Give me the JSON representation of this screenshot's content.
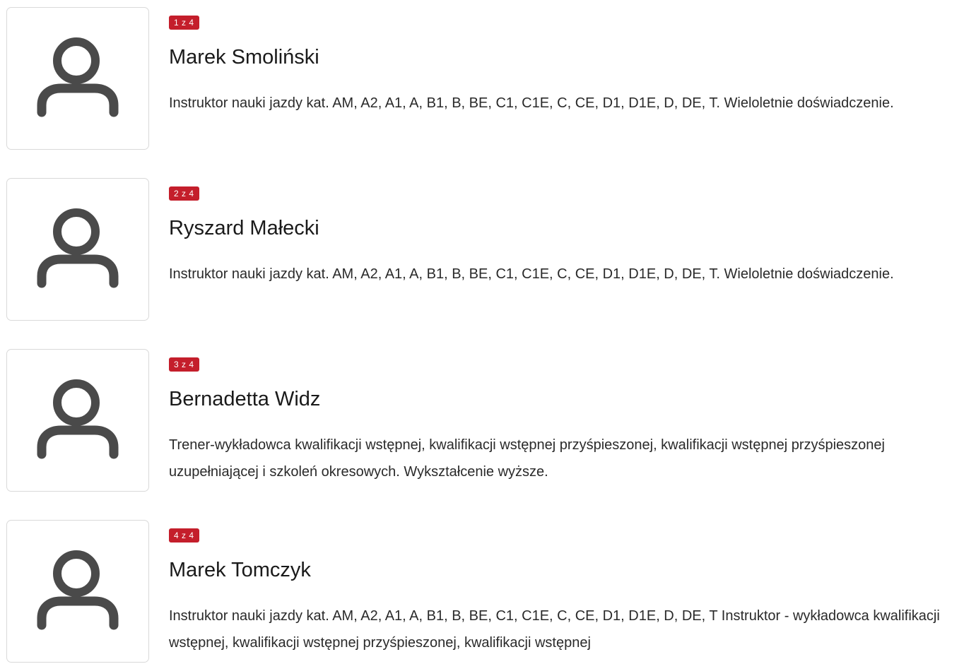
{
  "staff": [
    {
      "counter": "1 z 4",
      "name": "Marek Smoliński",
      "description": "Instruktor nauki jazdy kat. AM, A2, A1, A, B1, B, BE, C1, C1E, C, CE, D1, D1E, D, DE, T. Wieloletnie doświadczenie.",
      "avatar_icon": "user-outline-icon"
    },
    {
      "counter": "2 z 4",
      "name": "Ryszard Małecki",
      "description": "Instruktor nauki jazdy kat. AM, A2, A1, A, B1, B, BE, C1, C1E, C, CE, D1, D1E, D, DE, T. Wieloletnie doświadczenie.",
      "avatar_icon": "user-outline-icon"
    },
    {
      "counter": "3 z 4",
      "name": "Bernadetta Widz",
      "description": "Trener-wykładowca kwalifikacji wstępnej, kwalifikacji wstępnej przyśpieszonej, kwalifikacji wstępnej przyśpieszonej uzupełniającej i szkoleń okresowych. Wykształcenie wyższe.",
      "avatar_icon": "user-outline-icon"
    },
    {
      "counter": "4 z 4",
      "name": "Marek Tomczyk",
      "description": "Instruktor nauki jazdy kat. AM, A2, A1, A, B1, B, BE, C1, C1E, C, CE, D1, D1E, D, DE, T Instruktor - wykładowca kwalifikacji wstępnej, kwalifikacji wstępnej przyśpieszonej, kwalifikacji wstępnej",
      "avatar_icon": "user-outline-icon"
    }
  ],
  "colors": {
    "badge_background": "#c41e2b",
    "badge_text": "#ffffff",
    "icon_stroke": "#4a4a4a",
    "card_border": "#d9d9d9"
  }
}
